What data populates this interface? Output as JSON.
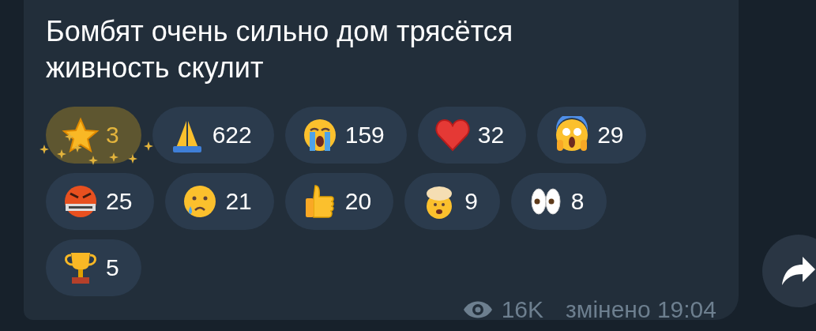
{
  "message": {
    "text_lines": [
      "Бомбят очень сильно дом трясётся",
      "живность скулит"
    ],
    "reactions": [
      {
        "kind": "star",
        "count": "3",
        "selected": true
      },
      {
        "kind": "pray",
        "count": "622",
        "selected": false
      },
      {
        "kind": "sob",
        "count": "159",
        "selected": false
      },
      {
        "kind": "heart",
        "count": "32",
        "selected": false
      },
      {
        "kind": "scream",
        "count": "29",
        "selected": false
      },
      {
        "kind": "cursing",
        "count": "25",
        "selected": false
      },
      {
        "kind": "cry",
        "count": "21",
        "selected": false
      },
      {
        "kind": "thumbsup",
        "count": "20",
        "selected": false
      },
      {
        "kind": "explode",
        "count": "9",
        "selected": false
      },
      {
        "kind": "eyes",
        "count": "8",
        "selected": false
      },
      {
        "kind": "trophy",
        "count": "5",
        "selected": false
      }
    ],
    "views": "16K",
    "status": "змінено 19:04"
  }
}
